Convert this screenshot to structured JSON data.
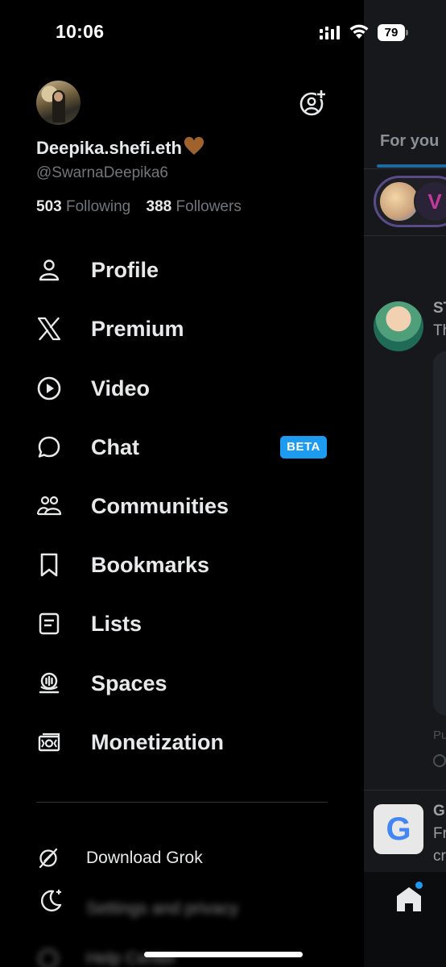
{
  "status_bar": {
    "time": "10:06",
    "battery": "79"
  },
  "profile": {
    "display_name": "Deepika.shefi.eth",
    "handle": "@SwarnaDeepika6",
    "following_count": "503",
    "following_label": "Following",
    "followers_count": "388",
    "followers_label": "Followers"
  },
  "menu": {
    "items": [
      {
        "label": "Profile",
        "icon": "person-icon"
      },
      {
        "label": "Premium",
        "icon": "x-logo-icon"
      },
      {
        "label": "Video",
        "icon": "play-circle-icon"
      },
      {
        "label": "Chat",
        "icon": "chat-bubble-icon",
        "badge": "BETA"
      },
      {
        "label": "Communities",
        "icon": "communities-icon"
      },
      {
        "label": "Bookmarks",
        "icon": "bookmark-icon"
      },
      {
        "label": "Lists",
        "icon": "list-icon"
      },
      {
        "label": "Spaces",
        "icon": "spaces-icon"
      },
      {
        "label": "Monetization",
        "icon": "monetization-icon"
      }
    ]
  },
  "secondary_menu": {
    "download_grok": "Download Grok",
    "settings": "Settings and privacy",
    "help": "Help Center"
  },
  "timeline": {
    "tab_for_you": "For you",
    "post_name": "ST",
    "post_text": "Th",
    "post_meta": "Pu",
    "ad_name": "G",
    "ad_line1": "Fr",
    "ad_line2": "cr"
  },
  "colors": {
    "accent": "#1d9bf0",
    "background": "#000000",
    "text_primary": "#e7e9ea",
    "text_secondary": "#71767b"
  }
}
